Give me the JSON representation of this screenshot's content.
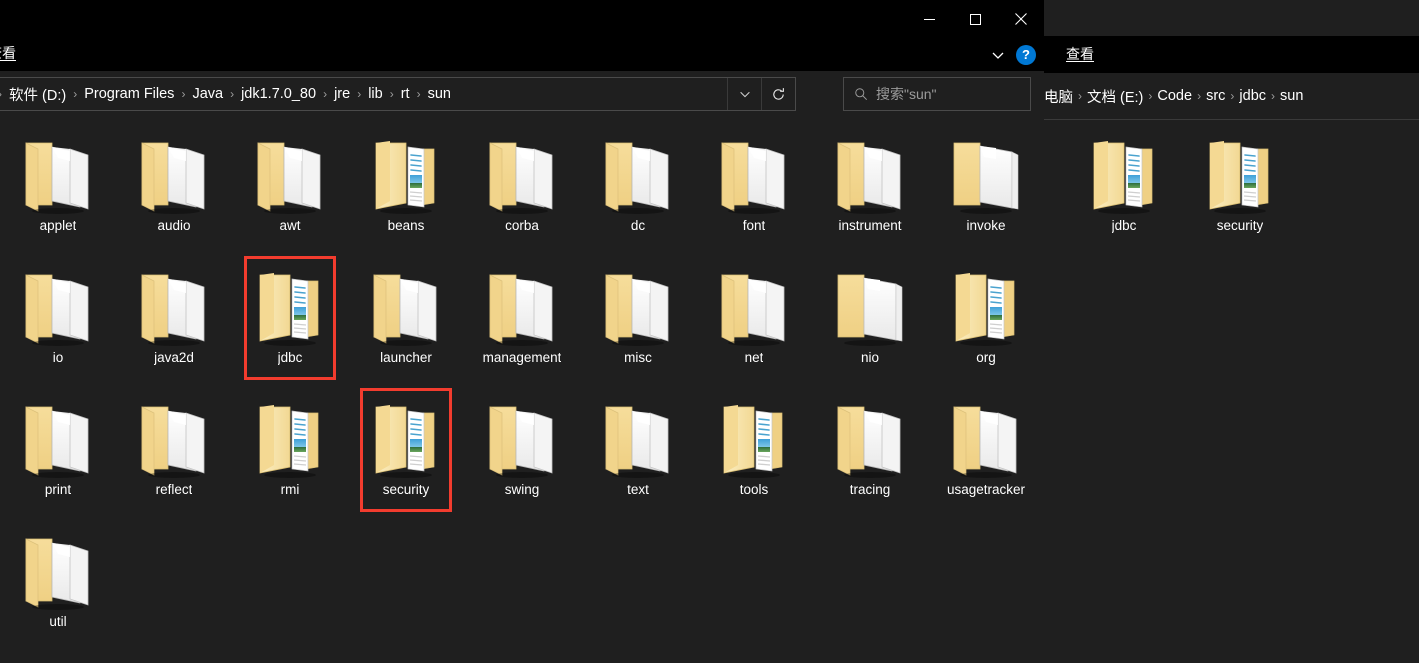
{
  "left_window": {
    "title": "",
    "window_controls": [
      {
        "name": "minimize",
        "glyph": "minimize-icon"
      },
      {
        "name": "maximize",
        "glyph": "maximize-icon"
      },
      {
        "name": "close",
        "glyph": "close-icon"
      }
    ],
    "ribbon": {
      "tab_label": "查看",
      "expand_icon": "chevron-down-icon",
      "help_label": "?"
    },
    "address": {
      "crumbs": [
        "软件 (D:)",
        "Program Files",
        "Java",
        "jdk1.7.0_80",
        "jre",
        "lib",
        "rt",
        "sun"
      ],
      "separator": "›",
      "dropdown_icon": "chevron-down-icon",
      "refresh_icon": "refresh-icon"
    },
    "search": {
      "icon": "search-icon",
      "placeholder": "搜索\"sun\""
    },
    "items": [
      {
        "label": "applet",
        "icon": "folder-docs",
        "marked": false
      },
      {
        "label": "audio",
        "icon": "folder-docs",
        "marked": false
      },
      {
        "label": "awt",
        "icon": "folder-docs",
        "marked": false
      },
      {
        "label": "beans",
        "icon": "folder-content",
        "marked": false
      },
      {
        "label": "corba",
        "icon": "folder-docs",
        "marked": false
      },
      {
        "label": "dc",
        "icon": "folder-docs",
        "marked": false
      },
      {
        "label": "font",
        "icon": "folder-docs",
        "marked": false
      },
      {
        "label": "instrument",
        "icon": "folder-docs",
        "marked": false
      },
      {
        "label": "invoke",
        "icon": "folder-plain",
        "marked": false
      },
      {
        "label": "io",
        "icon": "folder-docs",
        "marked": false
      },
      {
        "label": "java2d",
        "icon": "folder-docs",
        "marked": false
      },
      {
        "label": "jdbc",
        "icon": "folder-content",
        "marked": true
      },
      {
        "label": "launcher",
        "icon": "folder-docs",
        "marked": false
      },
      {
        "label": "management",
        "icon": "folder-docs",
        "marked": false
      },
      {
        "label": "misc",
        "icon": "folder-docs",
        "marked": false
      },
      {
        "label": "net",
        "icon": "folder-docs",
        "marked": false
      },
      {
        "label": "nio",
        "icon": "folder-plain",
        "marked": false
      },
      {
        "label": "org",
        "icon": "folder-content",
        "marked": false
      },
      {
        "label": "print",
        "icon": "folder-docs",
        "marked": false
      },
      {
        "label": "reflect",
        "icon": "folder-docs",
        "marked": false
      },
      {
        "label": "rmi",
        "icon": "folder-content",
        "marked": false
      },
      {
        "label": "security",
        "icon": "folder-content",
        "marked": true
      },
      {
        "label": "swing",
        "icon": "folder-docs",
        "marked": false
      },
      {
        "label": "text",
        "icon": "folder-docs",
        "marked": false
      },
      {
        "label": "tools",
        "icon": "folder-content",
        "marked": false
      },
      {
        "label": "tracing",
        "icon": "folder-docs",
        "marked": false
      },
      {
        "label": "usagetracker",
        "icon": "folder-docs",
        "marked": false
      },
      {
        "label": "util",
        "icon": "folder-docs",
        "marked": false
      }
    ]
  },
  "right_window": {
    "ribbon": {
      "tab_label": "查看"
    },
    "address": {
      "crumbs": [
        "电脑",
        "文档 (E:)",
        "Code",
        "src",
        "jdbc",
        "sun"
      ],
      "separator": "›"
    },
    "items": [
      {
        "label": "jdbc",
        "icon": "folder-content"
      },
      {
        "label": "security",
        "icon": "folder-content"
      }
    ]
  },
  "colors": {
    "window_bg": "#1f1f1f",
    "titlebar_bg": "#000000",
    "text": "#ffffff",
    "muted_text": "#9b9b9b",
    "accent_help": "#0078d4",
    "annotation_red": "#f23c2e",
    "folder_yellow": "#f7dd9a"
  }
}
